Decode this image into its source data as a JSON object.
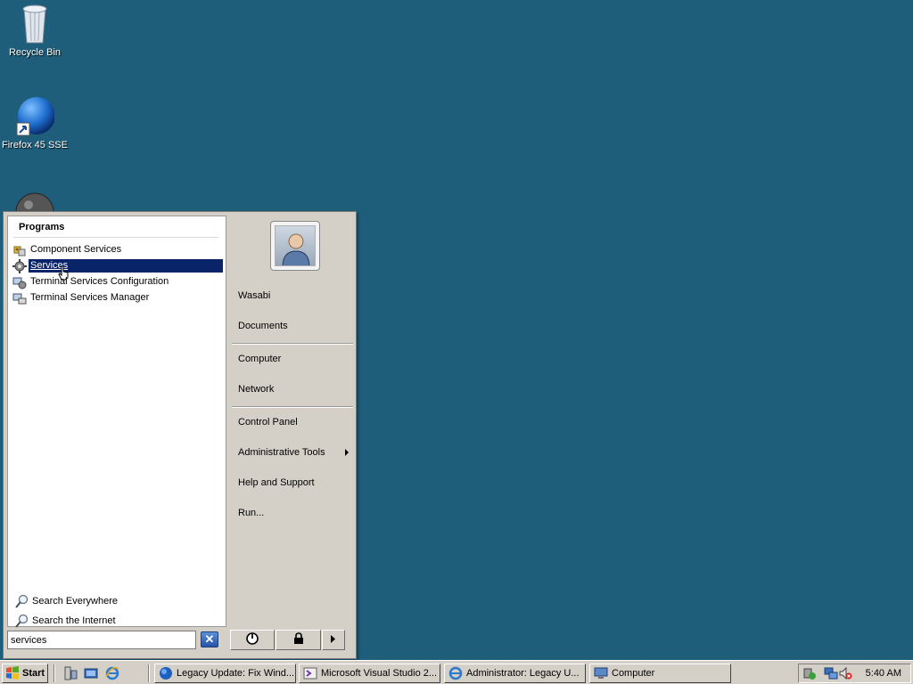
{
  "desktop": {
    "icons": [
      {
        "label": "Recycle Bin",
        "icon": "recycle-bin-icon"
      },
      {
        "label": "Firefox 45 SSE",
        "icon": "firefox-icon"
      },
      {
        "label": "",
        "icon": "globe-icon"
      }
    ]
  },
  "start_menu": {
    "programs_heading": "Programs",
    "programs": [
      {
        "label": "Component Services",
        "icon": "component-services-icon",
        "selected": false
      },
      {
        "label": "Services",
        "icon": "gear-icon",
        "selected": true
      },
      {
        "label": "Terminal Services Configuration",
        "icon": "terminal-services-config-icon",
        "selected": false
      },
      {
        "label": "Terminal Services Manager",
        "icon": "terminal-services-manager-icon",
        "selected": false
      }
    ],
    "search_links": [
      {
        "label": "Search Everywhere",
        "icon": "search-icon"
      },
      {
        "label": "Search the Internet",
        "icon": "search-icon"
      }
    ],
    "search_value": "services",
    "right_items": {
      "user": "Wasabi",
      "documents": "Documents",
      "computer": "Computer",
      "network": "Network",
      "control_panel": "Control Panel",
      "admin_tools": "Administrative Tools",
      "help": "Help and Support",
      "run": "Run..."
    }
  },
  "taskbar": {
    "start_label": "Start",
    "tasks": [
      {
        "label": "Legacy Update: Fix Wind...",
        "icon": "firefox-icon"
      },
      {
        "label": "Microsoft Visual Studio 2...",
        "icon": "visual-studio-icon"
      },
      {
        "label": "Administrator: Legacy U...",
        "icon": "internet-explorer-icon"
      },
      {
        "label": "Computer",
        "icon": "computer-icon"
      }
    ],
    "clock": "5:40 AM"
  },
  "colors": {
    "desktop_bg": "#1e5e7a",
    "selection": "#0a246a",
    "chrome": "#d4d0c8"
  }
}
